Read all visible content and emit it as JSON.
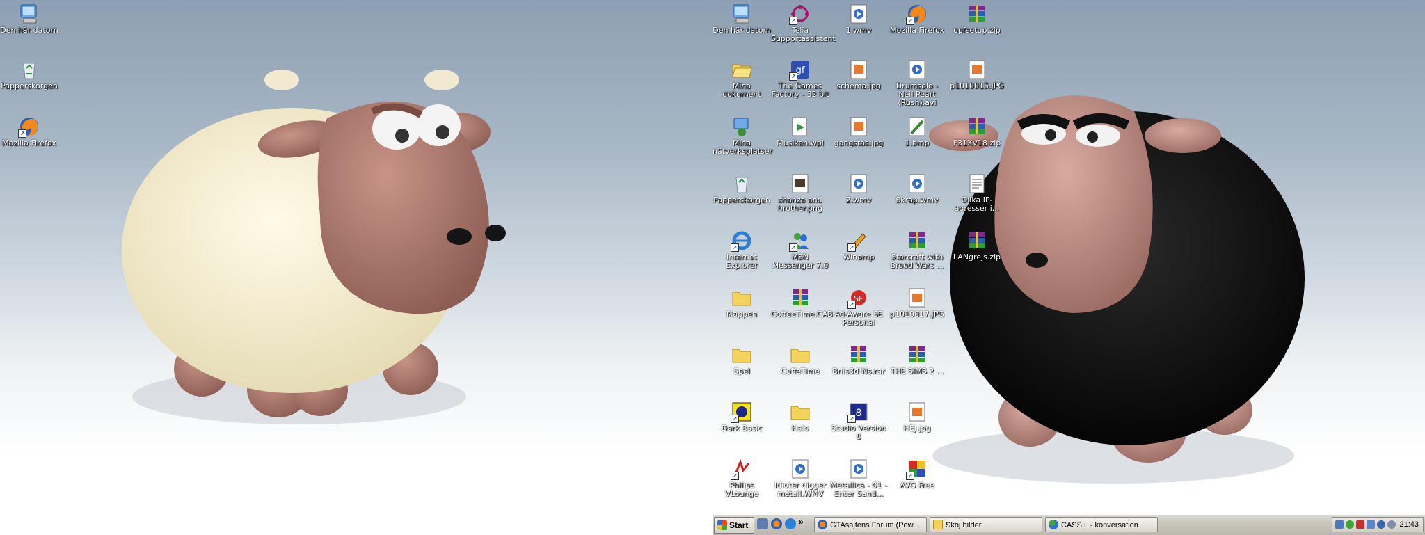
{
  "desktop": {
    "left_icons": [
      {
        "label": "Den här datorn",
        "icon": "computer-icon"
      },
      {
        "label": "Papperskorgen",
        "icon": "recycle-bin-icon"
      },
      {
        "label": "Mozilla Firefox",
        "icon": "firefox-icon"
      }
    ],
    "right_icons": [
      [
        {
          "label": "Den här datorn",
          "icon": "computer-icon"
        },
        {
          "label": "Mina dokument",
          "icon": "folder-open-icon"
        },
        {
          "label": "Mina nätverksplatser",
          "icon": "network-icon"
        },
        {
          "label": "Papperskorgen",
          "icon": "recycle-bin-icon"
        },
        {
          "label": "Internet Explorer",
          "icon": "ie-icon"
        },
        {
          "label": "Mappen",
          "icon": "folder-icon"
        },
        {
          "label": "Spel",
          "icon": "folder-icon"
        },
        {
          "label": "Dark Basic",
          "icon": "dark-basic-icon"
        },
        {
          "label": "Philips VLounge",
          "icon": "vlounge-icon"
        }
      ],
      [
        {
          "label": "Telia Supportassistent",
          "icon": "telia-icon"
        },
        {
          "label": "The Games Factory - 32 bit",
          "icon": "games-factory-icon"
        },
        {
          "label": "Musiken.wpl",
          "icon": "playlist-icon"
        },
        {
          "label": "shanza and brother.png",
          "icon": "image-icon"
        },
        {
          "label": "MSN Messenger 7.0",
          "icon": "msn-icon"
        },
        {
          "label": "CoffeeTime.CAB",
          "icon": "winrar-icon"
        },
        {
          "label": "CoffeTime",
          "icon": "folder-icon"
        },
        {
          "label": "Halo",
          "icon": "folder-icon"
        },
        {
          "label": "Idioter digger metall.WMV",
          "icon": "media-icon"
        }
      ],
      [
        {
          "label": "1.wmv",
          "icon": "media-icon"
        },
        {
          "label": "schema.jpg",
          "icon": "jpg-icon"
        },
        {
          "label": "gangstas.jpg",
          "icon": "jpg-icon"
        },
        {
          "label": "2.wmv",
          "icon": "media-icon"
        },
        {
          "label": "Winamp",
          "icon": "winamp-icon"
        },
        {
          "label": "Ad-Aware SE Personal",
          "icon": "adaware-icon"
        },
        {
          "label": "Brils3d!Ns.rar",
          "icon": "winrar-icon"
        },
        {
          "label": "Studio Version 8",
          "icon": "studio-icon"
        },
        {
          "label": "Metallica - 01 - Enter Sand...",
          "icon": "media-icon"
        }
      ],
      [
        {
          "label": "Mozilla Firefox",
          "icon": "firefox-icon"
        },
        {
          "label": "Drumsolo - Neil Peart (Rush).avi",
          "icon": "media-icon"
        },
        {
          "label": "1.bmp",
          "icon": "bmp-icon"
        },
        {
          "label": "Skrap.wmv",
          "icon": "media-icon"
        },
        {
          "label": "Starcraft with Brood Wars ...",
          "icon": "winrar-icon"
        },
        {
          "label": "p1010017.JPG",
          "icon": "jpg-icon"
        },
        {
          "label": "THE SIMS 2 ...",
          "icon": "winrar-icon"
        },
        {
          "label": "HEJ.jpg",
          "icon": "jpg-icon"
        },
        {
          "label": "AVG Free",
          "icon": "avg-icon"
        }
      ],
      [
        {
          "label": "opfsetup.zip",
          "icon": "winrar-icon"
        },
        {
          "label": "p1010015.JPG",
          "icon": "jpg-icon"
        },
        {
          "label": "F31XV18.zip",
          "icon": "winrar-icon"
        },
        {
          "label": "Olika IP-adresser i...",
          "icon": "text-file-icon"
        },
        {
          "label": "LANgrejs.zip",
          "icon": "winrar-icon"
        }
      ]
    ]
  },
  "taskbar": {
    "start_label": "Start",
    "overflow_label": "»",
    "tasks": [
      {
        "label": "GTAsajtens Forum (Pow...",
        "icon": "firefox-icon"
      },
      {
        "label": "Skoj bilder",
        "icon": "folder-icon"
      },
      {
        "label": "CASSIL - konversation",
        "icon": "msn-icon"
      }
    ],
    "clock": "21:43"
  },
  "colors": {
    "label_text": "#ffffff",
    "taskbar": "#c9c6bd"
  }
}
